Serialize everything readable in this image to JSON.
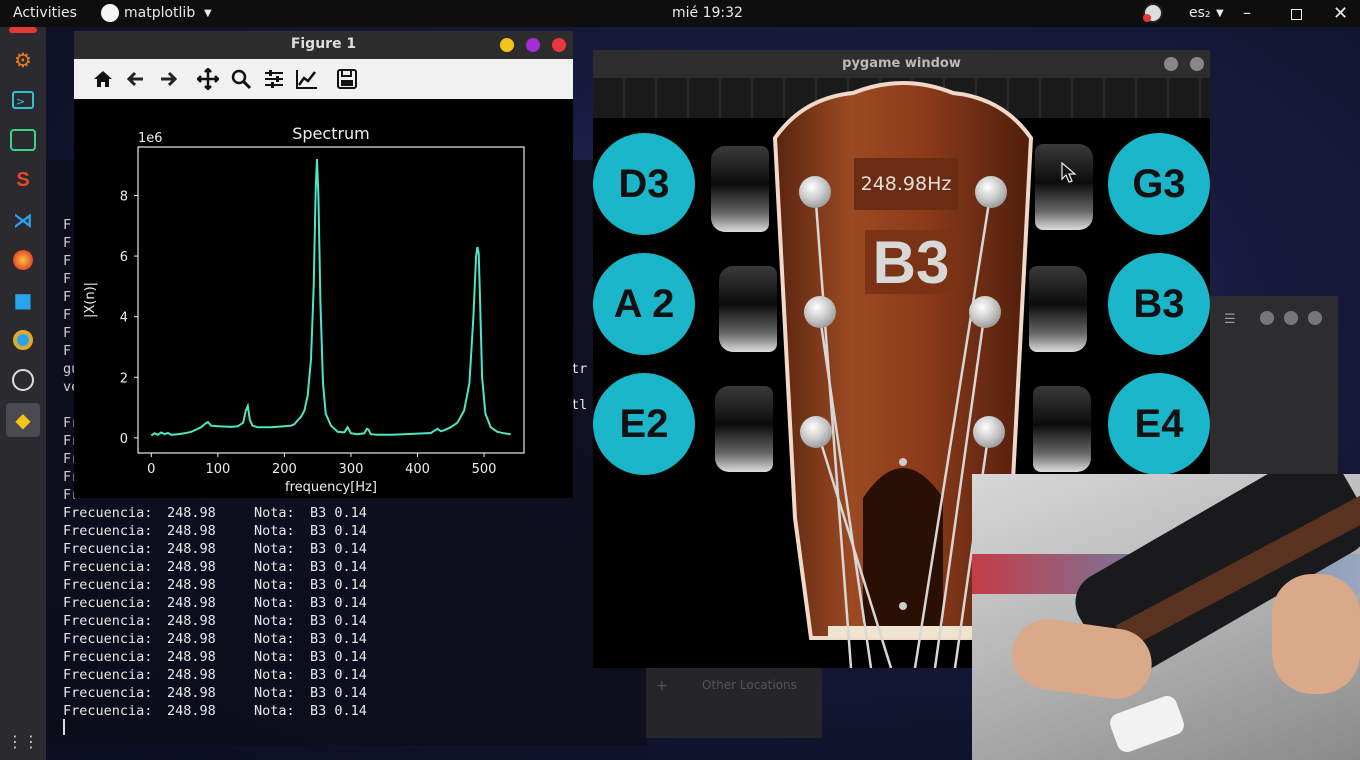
{
  "topbar": {
    "activities": "Activities",
    "app_name": "matplotlib",
    "clock": "mié 19:32",
    "language": "es₂"
  },
  "terminal": {
    "left_fragments": [
      "F",
      "F",
      "F",
      "F",
      "F",
      "F",
      "F",
      "F",
      "gu",
      "ve",
      "Fr",
      "Fr",
      "Fr",
      "Fr",
      "Fr"
    ],
    "right_fragments": [
      "tr",
      "tl"
    ],
    "lines": [
      {
        "label": "Frecuencia:",
        "freq": "248.98",
        "nota_label": "Nota:",
        "note": "B3 0.14"
      },
      {
        "label": "Frecuencia:",
        "freq": "248.98",
        "nota_label": "Nota:",
        "note": "B3 0.14"
      },
      {
        "label": "Frecuencia:",
        "freq": "248.98",
        "nota_label": "Nota:",
        "note": "B3 0.14"
      },
      {
        "label": "Frecuencia:",
        "freq": "248.98",
        "nota_label": "Nota:",
        "note": "B3 0.14"
      },
      {
        "label": "Frecuencia:",
        "freq": "248.98",
        "nota_label": "Nota:",
        "note": "B3 0.14"
      },
      {
        "label": "Frecuencia:",
        "freq": "248.98",
        "nota_label": "Nota:",
        "note": "B3 0.14"
      },
      {
        "label": "Frecuencia:",
        "freq": "248.98",
        "nota_label": "Nota:",
        "note": "B3 0.14"
      },
      {
        "label": "Frecuencia:",
        "freq": "248.98",
        "nota_label": "Nota:",
        "note": "B3 0.14"
      },
      {
        "label": "Frecuencia:",
        "freq": "248.98",
        "nota_label": "Nota:",
        "note": "B3 0.14"
      },
      {
        "label": "Frecuencia:",
        "freq": "248.98",
        "nota_label": "Nota:",
        "note": "B3 0.14"
      },
      {
        "label": "Frecuencia:",
        "freq": "248.98",
        "nota_label": "Nota:",
        "note": "B3 0.14"
      },
      {
        "label": "Frecuencia:",
        "freq": "248.98",
        "nota_label": "Nota:",
        "note": "B3 0.14"
      }
    ]
  },
  "background_window": {
    "location_text": "Other Locations"
  },
  "figure_window": {
    "title": "Figure 1",
    "toolbar": [
      "home-icon",
      "back-arrow-icon",
      "forward-arrow-icon",
      "move-icon",
      "zoom-icon",
      "configure-subplots-icon",
      "edit-axis-icon",
      "save-icon"
    ],
    "controls_colors": {
      "minimize": "#f3c51b",
      "maximize": "#a42ed6",
      "close": "#e8383d"
    }
  },
  "chart_data": {
    "type": "line",
    "title": "Spectrum",
    "xlabel": "frequency[Hz]",
    "ylabel": "|X(n)|",
    "offset_label": "1e6",
    "xlim": [
      -20,
      560
    ],
    "ylim": [
      -0.5,
      9.6
    ],
    "xticks": [
      0,
      100,
      200,
      300,
      400,
      500
    ],
    "yticks": [
      0,
      2,
      4,
      6,
      8
    ],
    "line_color": "#4fe5c4",
    "background": "#000000",
    "grid": false,
    "series": [
      {
        "x": [
          0,
          5,
          10,
          15,
          20,
          25,
          30,
          40,
          50,
          60,
          70,
          75,
          80,
          85,
          90,
          100,
          120,
          130,
          138,
          142,
          145,
          148,
          152,
          160,
          180,
          200,
          210,
          215,
          220,
          225,
          230,
          235,
          240,
          244,
          247,
          249,
          251,
          254,
          258,
          262,
          270,
          280,
          290,
          295,
          300,
          310,
          320,
          324,
          326,
          330,
          340,
          360,
          380,
          400,
          420,
          430,
          435,
          440,
          450,
          460,
          470,
          478,
          484,
          488,
          490,
          492,
          494,
          497,
          502,
          510,
          520,
          530,
          540
        ],
        "y": [
          0.08,
          0.15,
          0.1,
          0.18,
          0.12,
          0.16,
          0.1,
          0.12,
          0.15,
          0.2,
          0.3,
          0.35,
          0.45,
          0.52,
          0.4,
          0.38,
          0.36,
          0.38,
          0.5,
          0.9,
          1.05,
          0.6,
          0.4,
          0.35,
          0.35,
          0.38,
          0.4,
          0.45,
          0.58,
          0.7,
          0.9,
          1.4,
          2.6,
          5.0,
          8.2,
          9.2,
          8.0,
          4.5,
          1.8,
          0.8,
          0.4,
          0.2,
          0.18,
          0.35,
          0.15,
          0.12,
          0.15,
          0.3,
          0.28,
          0.12,
          0.1,
          0.1,
          0.12,
          0.14,
          0.16,
          0.3,
          0.22,
          0.25,
          0.35,
          0.5,
          0.9,
          1.8,
          4.0,
          6.0,
          6.3,
          6.1,
          4.5,
          2.0,
          0.8,
          0.35,
          0.2,
          0.15,
          0.12
        ]
      }
    ]
  },
  "pygame_window": {
    "title": "pygame window",
    "frequency": "248.98Hz",
    "detected_note": "B3",
    "left_buttons": [
      "D3",
      "A 2",
      "E2"
    ],
    "right_buttons": [
      "G3",
      "B3",
      "E4"
    ],
    "button_color": "#1bb6c9",
    "headstock_color": "#8a3a1a"
  }
}
